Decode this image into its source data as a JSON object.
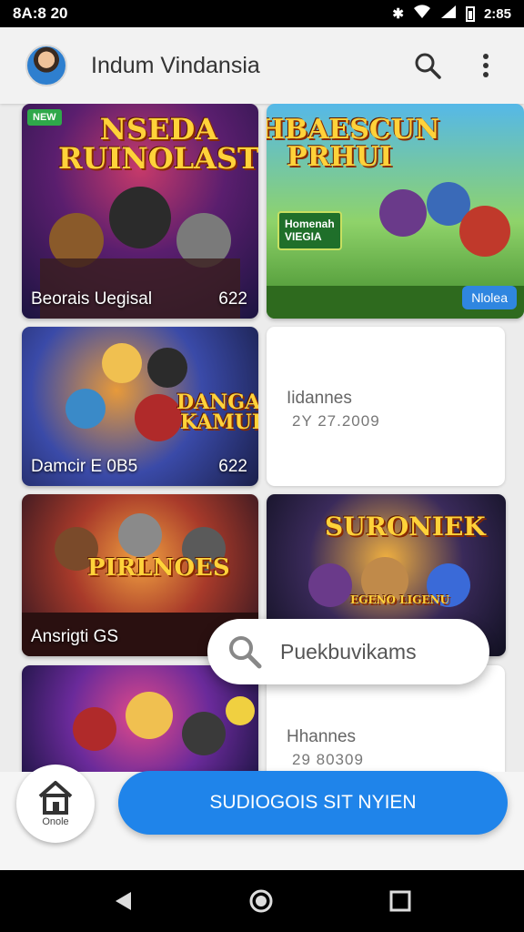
{
  "status_bar": {
    "time": "8A:8 20",
    "right_time": "2:85"
  },
  "app_bar": {
    "title": "Indum Vindansia"
  },
  "tiles": [
    {
      "logo": "NSEDA\nRUINOLAST",
      "caption": "Beorais Uegisal",
      "number": "622",
      "badge": ""
    },
    {
      "logo": "YHBAESCUN\nPRHUI",
      "sub_badge": "Homenah\nVIEGIA",
      "pill": "Nlolea",
      "label_tag": ""
    },
    {
      "logo": "DANGAL\nKAMUH",
      "caption": "Damcir E 0B5",
      "number": "622"
    },
    {
      "logo": "PIRLNOES",
      "caption": "Ansrigti GS"
    },
    {
      "logo": "SURONIEK",
      "sub_logo": "EGENO LIGENU"
    },
    {
      "logo": ""
    }
  ],
  "info_cards": [
    {
      "title": "Iidannes",
      "sub": "2Y 27.2009"
    },
    {
      "title": "Hhannes",
      "sub": "29 80309"
    }
  ],
  "search_chip": {
    "text": "Puekbuvikams"
  },
  "home_button": {
    "label": "Onole"
  },
  "cta_button": {
    "label": "SUDIOGOIS SIT NYIEN"
  },
  "colors": {
    "accent": "#1f84ea",
    "status_bg": "#000000",
    "badge_green": "#2fa84a"
  }
}
